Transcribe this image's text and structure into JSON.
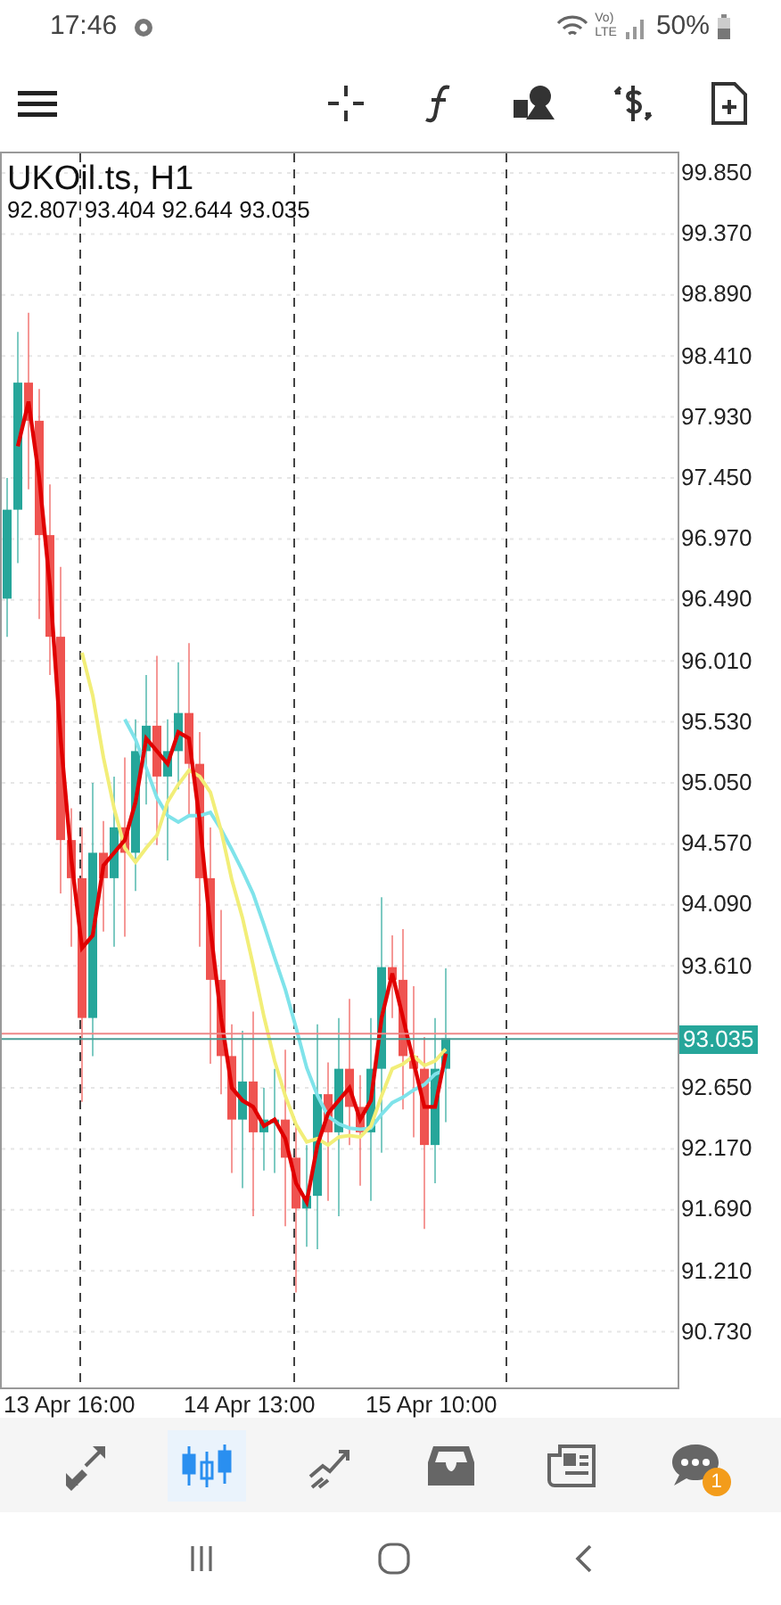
{
  "status_bar": {
    "time": "17:46",
    "network": [
      "Vo)",
      "LTE"
    ],
    "battery": "50%"
  },
  "toolbar": {
    "items": [
      {
        "kind": "crosshair"
      },
      {
        "kind": "function"
      },
      {
        "kind": "objects"
      },
      {
        "kind": "symbols"
      },
      {
        "kind": "new-order"
      }
    ]
  },
  "chart": {
    "title": "UKOil.ts, H1",
    "ohlc": "92.807 93.404 92.644 93.035",
    "price_axis": [
      "99.850",
      "99.370",
      "98.890",
      "98.410",
      "97.930",
      "97.450",
      "96.970",
      "96.490",
      "96.010",
      "95.530",
      "95.050",
      "94.570",
      "94.090",
      "93.610",
      "92.650",
      "92.170",
      "91.690",
      "91.210",
      "90.730"
    ],
    "current_price": "93.035",
    "time_axis": [
      "13 Apr 16:00",
      "14 Apr 13:00",
      "15 Apr 10:00"
    ]
  },
  "bottom_nav": [
    {
      "kind": "quotes",
      "selected": false
    },
    {
      "kind": "chart",
      "selected": true
    },
    {
      "kind": "trade",
      "selected": false
    },
    {
      "kind": "history",
      "selected": false
    },
    {
      "kind": "news",
      "selected": false
    },
    {
      "kind": "chat",
      "selected": false,
      "badge": "1"
    }
  ]
}
